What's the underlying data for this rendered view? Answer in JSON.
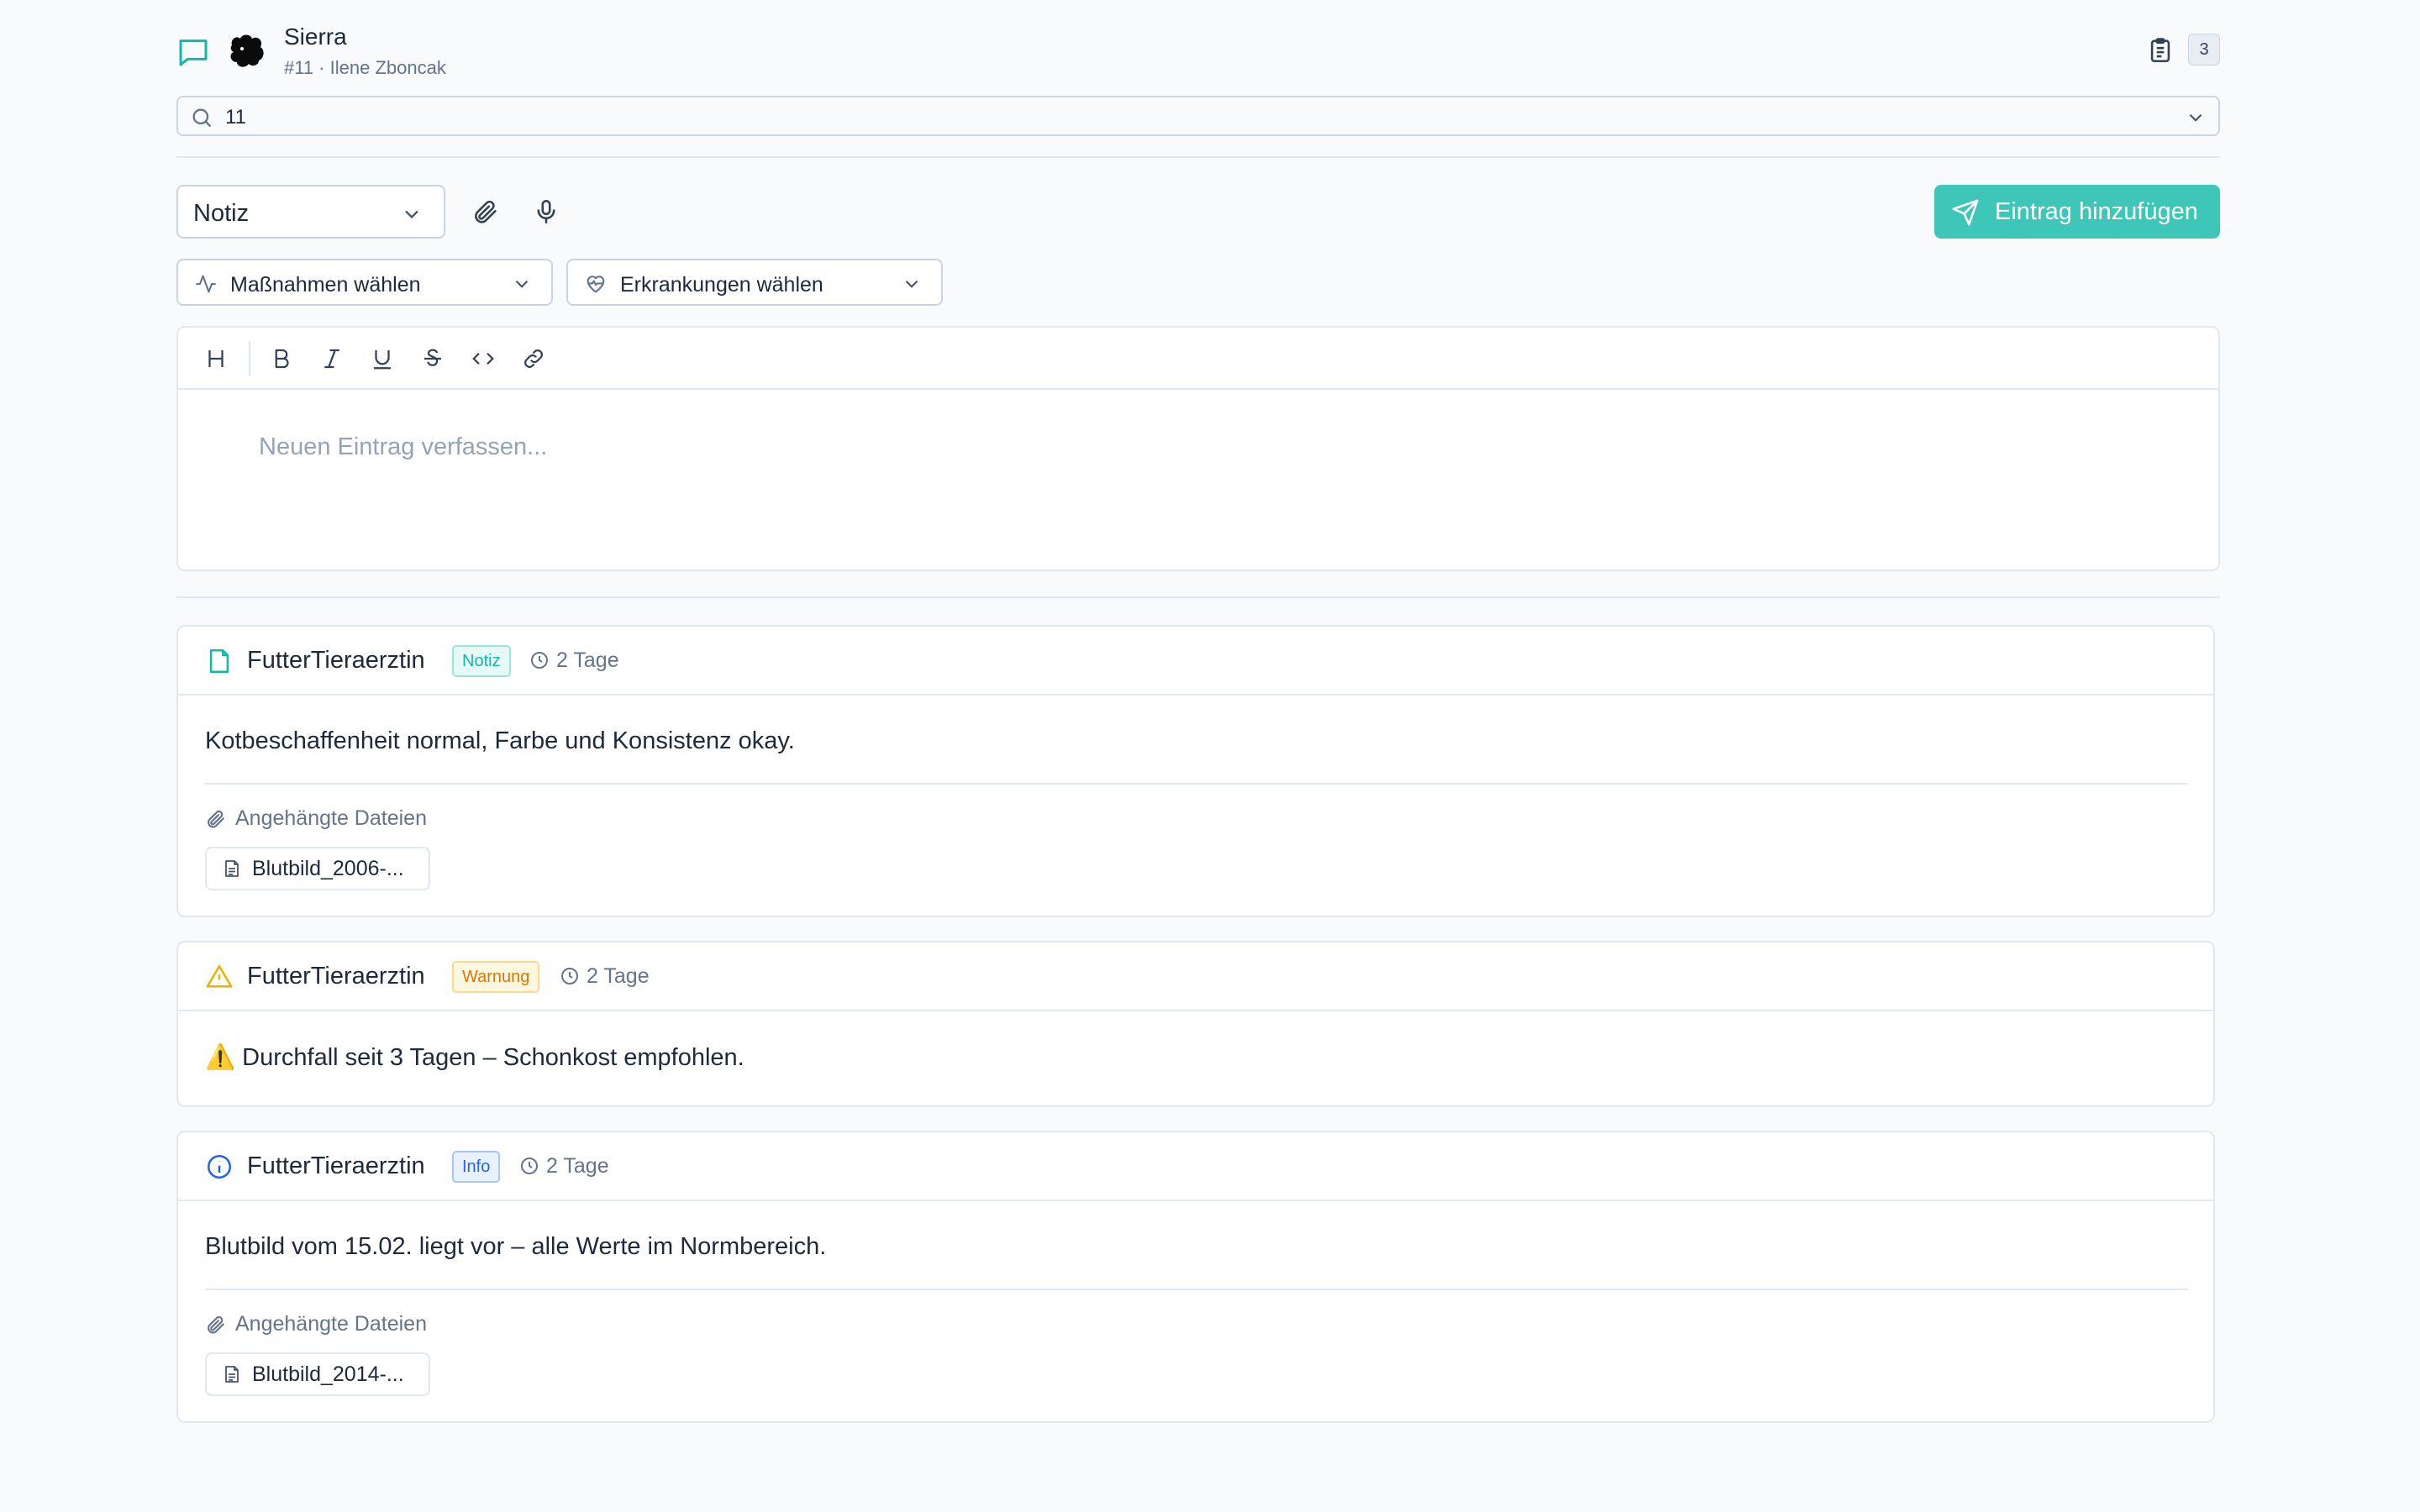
{
  "header": {
    "pet_name": "Sierra",
    "pet_subtitle": "#11 · Ilene Zboncak",
    "count": "3"
  },
  "search": {
    "value": "11"
  },
  "composer": {
    "entry_type": "Notiz",
    "add_label": "Eintrag hinzufügen",
    "measures_label": "Maßnahmen wählen",
    "diseases_label": "Erkrankungen wählen",
    "placeholder": "Neuen Eintrag verfassen..."
  },
  "colors": {
    "accent": "#3ec7b8",
    "warning": "#d97706",
    "info": "#2563eb"
  },
  "entries": [
    {
      "icon": "file-icon",
      "author": "FutterTieraerztin",
      "tag": "Notiz",
      "time": "2 Tage",
      "body": "Kotbeschaffenheit normal, Farbe und Konsistenz okay.",
      "attachments_label": "Angehängte Dateien",
      "file": "Blutbild_2006-..."
    },
    {
      "icon": "warning-icon",
      "author": "FutterTieraerztin",
      "tag": "Warnung",
      "time": "2 Tage",
      "body": "⚠️ Durchfall seit 3 Tagen – Schonkost empfohlen."
    },
    {
      "icon": "info-icon",
      "author": "FutterTieraerztin",
      "tag": "Info",
      "time": "2 Tage",
      "body": "Blutbild vom 15.02. liegt vor – alle Werte im Normbereich.",
      "attachments_label": "Angehängte Dateien",
      "file": "Blutbild_2014-..."
    }
  ]
}
